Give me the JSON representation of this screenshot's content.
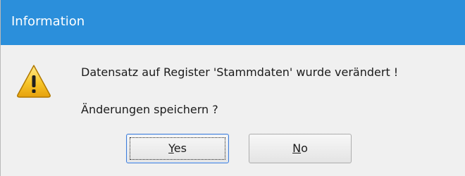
{
  "window": {
    "title": "Information",
    "title_bar_color": "#2b8fdb"
  },
  "icon": {
    "name": "warning-icon"
  },
  "message": {
    "line1": "Datensatz auf Register 'Stammdaten' wurde verändert !",
    "line2": "Änderungen speichern ?"
  },
  "buttons": {
    "yes": {
      "mnemonic": "Y",
      "rest": "es"
    },
    "no": {
      "mnemonic": "N",
      "rest": "o"
    }
  }
}
